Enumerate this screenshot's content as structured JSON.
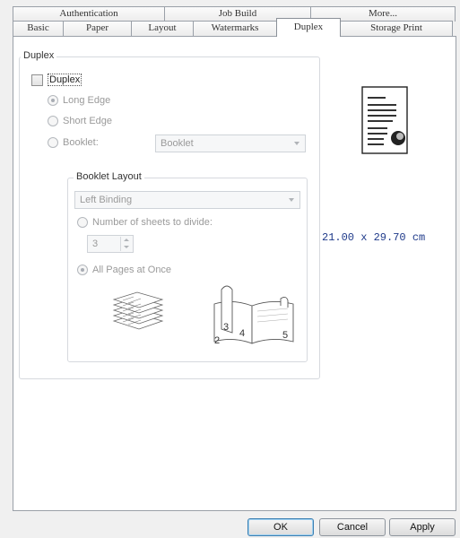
{
  "tabs_top": [
    "Authentication",
    "Job Build",
    "More..."
  ],
  "tabs_bottom": [
    "Basic",
    "Paper",
    "Layout",
    "Watermarks",
    "Duplex",
    "Storage Print"
  ],
  "active_tab": "Duplex",
  "duplex_group": {
    "legend": "Duplex",
    "duplex_checkbox_label": "Duplex",
    "duplex_checked": false,
    "options": [
      "Long Edge",
      "Short Edge",
      "Booklet:"
    ],
    "selected_option": "Long Edge",
    "booklet_combo_value": "Booklet"
  },
  "booklet_layout": {
    "legend": "Booklet Layout",
    "binding_combo_value": "Left Binding",
    "sheets_label": "Number of sheets to divide:",
    "sheets_value": "3",
    "all_pages_label": "All Pages at Once",
    "all_pages_selected": true,
    "illustration_numbers": [
      "2",
      "3",
      "4",
      "5"
    ]
  },
  "paper_size": "21.00 x 29.70 cm",
  "buttons": {
    "ok": "OK",
    "cancel": "Cancel",
    "apply": "Apply"
  }
}
